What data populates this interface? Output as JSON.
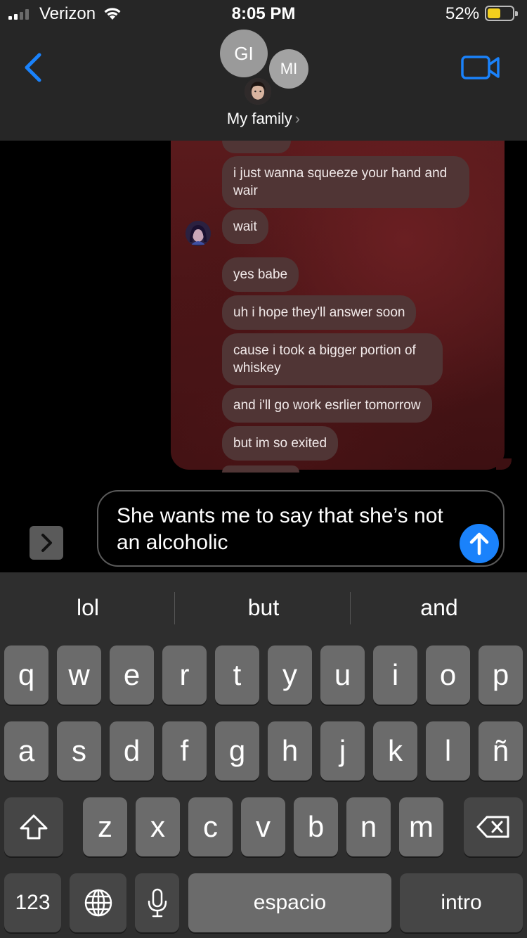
{
  "status_bar": {
    "carrier": "Verizon",
    "time": "8:05 PM",
    "battery_percent": "52%",
    "battery_level": 0.52,
    "signal_bars": 2,
    "icons": [
      "signal-icon",
      "wifi-icon",
      "battery-icon"
    ]
  },
  "header": {
    "avatars": [
      "GI",
      "MI"
    ],
    "group_name": "My family",
    "chevron": "›",
    "icons": [
      "back-chevron-icon",
      "video-camera-icon"
    ],
    "accent_color": "#1a82fb"
  },
  "conversation": {
    "screenshot_messages": [
      "i just wanna squeeze your hand and wair",
      "wait",
      "yes babe",
      "uh i hope they'll answer soon",
      "cause i took a bigger portion of whiskey",
      "and i'll go work esrlier tomorrow",
      "but im so exited"
    ]
  },
  "composer": {
    "text": "She wants me to say that she’s not an alcoholic",
    "apps_icon": "chevron-right-icon",
    "send_icon": "arrow-up-icon"
  },
  "keyboard": {
    "suggestions": [
      "lol",
      "but",
      "and"
    ],
    "row1": [
      "q",
      "w",
      "e",
      "r",
      "t",
      "y",
      "u",
      "i",
      "o",
      "p"
    ],
    "row2": [
      "a",
      "s",
      "d",
      "f",
      "g",
      "h",
      "j",
      "k",
      "l",
      "ñ"
    ],
    "row3": [
      "z",
      "x",
      "c",
      "v",
      "b",
      "n",
      "m"
    ],
    "numbers_label": "123",
    "space_label": "espacio",
    "return_label": "intro",
    "icons": [
      "shift-icon",
      "delete-icon",
      "globe-icon",
      "microphone-icon"
    ]
  }
}
